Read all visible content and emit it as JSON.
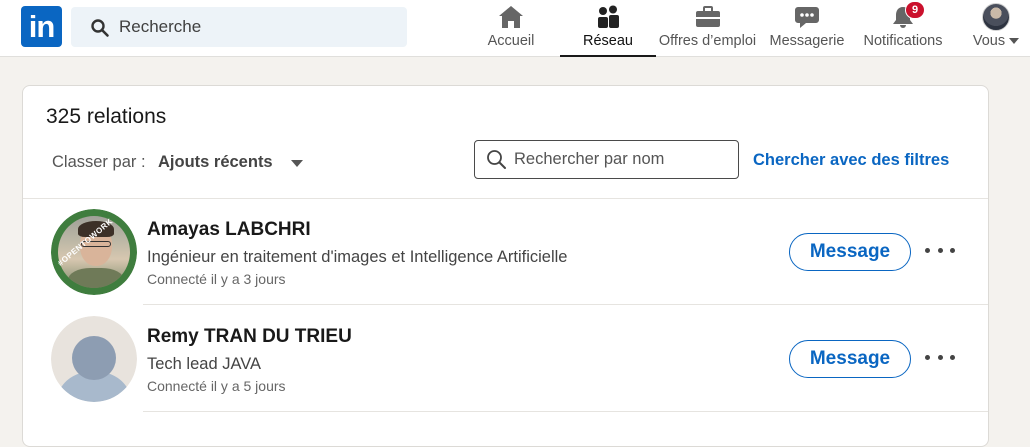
{
  "brand": {
    "logo_text": "in",
    "accent_color": "#0a66c2"
  },
  "search": {
    "placeholder": "Recherche"
  },
  "nav": {
    "items": [
      {
        "label": "Accueil",
        "icon": "home-icon"
      },
      {
        "label": "Réseau",
        "icon": "network-icon",
        "active": true
      },
      {
        "label": "Offres d’emploi",
        "icon": "briefcase-icon"
      },
      {
        "label": "Messagerie",
        "icon": "messaging-icon"
      },
      {
        "label": "Notifications",
        "icon": "bell-icon",
        "badge": "9"
      },
      {
        "label": "Vous",
        "icon": "profile-avatar"
      }
    ]
  },
  "connections": {
    "count_label": "325 relations",
    "sort_label": "Classer par :",
    "sort_value": "Ajouts récents",
    "search_placeholder": "Rechercher par nom",
    "filters_link": "Chercher avec des filtres",
    "items": [
      {
        "name": "Amayas LABCHRI",
        "headline": "Ingénieur en traitement d'images et Intelligence Artificielle",
        "connected": "Connecté il y a 3 jours",
        "avatar_frame": "#OPENTOWORK",
        "message_label": "Message"
      },
      {
        "name": "Remy TRAN DU TRIEU",
        "headline": "Tech lead JAVA",
        "connected": "Connecté il y a 5 jours",
        "message_label": "Message"
      }
    ]
  }
}
